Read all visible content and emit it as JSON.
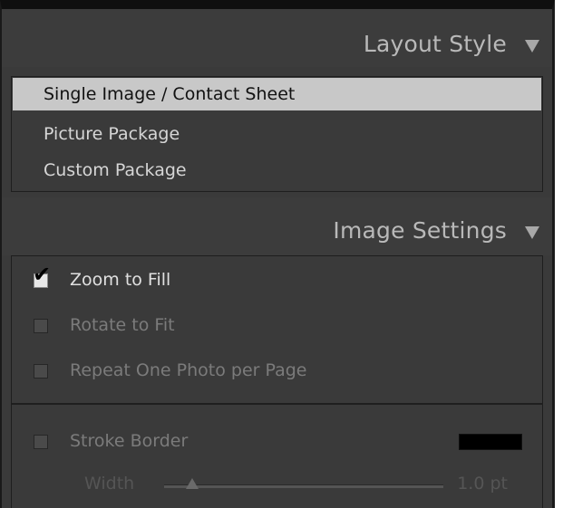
{
  "layout_style": {
    "title": "Layout Style",
    "items": [
      {
        "label": "Single Image / Contact Sheet",
        "selected": true
      },
      {
        "label": "Picture Package",
        "selected": false
      },
      {
        "label": "Custom Package",
        "selected": false
      }
    ]
  },
  "image_settings": {
    "title": "Image Settings",
    "options": [
      {
        "label": "Zoom to Fill",
        "checked": true
      },
      {
        "label": "Rotate to Fit",
        "checked": false
      },
      {
        "label": "Repeat One Photo per Page",
        "checked": false
      }
    ],
    "stroke_border": {
      "label": "Stroke Border",
      "checked": false,
      "color": "#000000",
      "width_label": "Width",
      "width_value": "1.0 pt",
      "width_fraction": 0.1
    }
  },
  "icons": {
    "collapse": "triangle-down-icon",
    "check": "checkmark-icon"
  },
  "colors": {
    "panel_bg": "#3a3a3a",
    "selected_bg": "#c8c8c8",
    "header_text": "#b9b9b9"
  }
}
